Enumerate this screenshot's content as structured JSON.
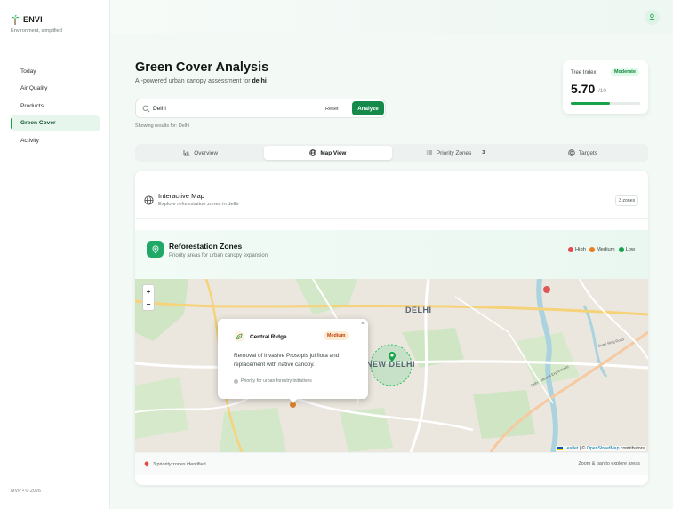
{
  "app": {
    "name": "ENVI",
    "tagline": "Environment, simplified",
    "footer": "MVP • © 2026"
  },
  "sidebar": {
    "items": [
      {
        "label": "Today"
      },
      {
        "label": "Air Quality"
      },
      {
        "label": "Products"
      },
      {
        "label": "Green Cover",
        "active": true
      },
      {
        "label": "Activity"
      }
    ]
  },
  "header": {
    "title": "Green Cover Analysis",
    "subtitle_prefix": "AI-powered urban canopy assessment for ",
    "subtitle_city": "delhi"
  },
  "tree_index": {
    "label": "Tree Index",
    "badge": "Moderate",
    "value": "5.70",
    "out_of": "/10",
    "fraction": 0.57
  },
  "search": {
    "value": "Delhi",
    "placeholder": "Search city",
    "reset_label": "Reset",
    "analyze_label": "Analyze",
    "showing_text": "Showing results for: Delhi"
  },
  "tabs": [
    {
      "label": "Overview",
      "icon": "bar-chart-icon"
    },
    {
      "label": "Map View",
      "icon": "globe-icon",
      "active": true
    },
    {
      "label": "Priority Zones",
      "icon": "list-icon",
      "count": "3"
    },
    {
      "label": "Targets",
      "icon": "target-icon"
    }
  ],
  "interactive_map": {
    "title": "Interactive Map",
    "subtitle": "Explore reforestation zones in delhi",
    "zones_chip": "3 zones"
  },
  "reforestation": {
    "title": "Reforestation Zones",
    "subtitle": "Priority areas for urban canopy expansion",
    "legend": [
      {
        "label": "High",
        "color": "#e34b4b"
      },
      {
        "label": "Medium",
        "color": "#ee7a1e"
      },
      {
        "label": "Low",
        "color": "#16a34a"
      }
    ]
  },
  "map": {
    "label_delhi": "DELHI",
    "label_new_delhi": "NEW DELHI",
    "zoom_in": "+",
    "zoom_out": "−",
    "attribution_leaflet": "Leaflet",
    "attribution_sep": " | © ",
    "attribution_osm": "OpenStreetMap",
    "attribution_tail": " contributors",
    "road_label_1": "Delhi - Meerut Expressway",
    "road_label_2": "Outer Ring Road"
  },
  "popup": {
    "title": "Central Ridge",
    "badge": "Medium",
    "description": "Removal of invasive Prosopis juliflora and replacement with native canopy.",
    "priority_text": "Priority for urban forestry initiatives",
    "close": "×"
  },
  "panel_footer": {
    "left": "3 priority zones identified",
    "right": "Zoom & pan to explore areas"
  }
}
